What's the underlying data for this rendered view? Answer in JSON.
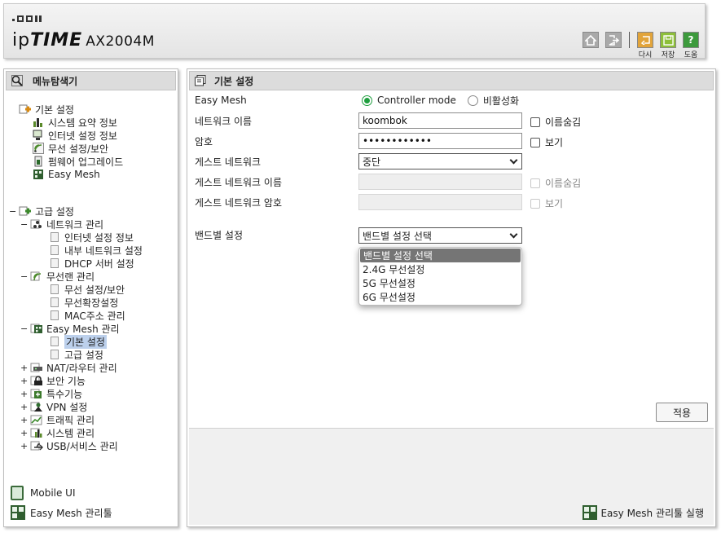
{
  "header": {
    "brand_ip": "ip",
    "brand_time": "TIME",
    "model": "AX2004M",
    "buttons": [
      {
        "icon": "home-icon"
      },
      {
        "icon": "logout-icon"
      },
      {
        "icon": "reload-icon",
        "label": "다시"
      },
      {
        "icon": "save-icon",
        "label": "저장"
      },
      {
        "icon": "help-icon",
        "label": "도움"
      }
    ]
  },
  "sidebar": {
    "title": "메뉴탐색기",
    "basic": {
      "label": "기본 설정",
      "items": [
        "시스템 요약 정보",
        "인터넷 설정 정보",
        "무선 설정/보안",
        "펌웨어 업그레이드",
        "Easy Mesh"
      ]
    },
    "advanced": {
      "label": "고급 설정",
      "network": {
        "label": "네트워크 관리",
        "items": [
          "인터넷 설정 정보",
          "내부 네트워크 설정",
          "DHCP 서버 설정"
        ]
      },
      "wireless": {
        "label": "무선랜 관리",
        "items": [
          "무선 설정/보안",
          "무선확장설정",
          "MAC주소 관리"
        ]
      },
      "easymesh": {
        "label": "Easy Mesh 관리",
        "items": [
          "기본 설정",
          "고급 설정"
        ]
      },
      "others": [
        "NAT/라우터 관리",
        "보안 기능",
        "특수기능",
        "VPN 설정",
        "트래픽 관리",
        "시스템 관리",
        "USB/서비스 관리"
      ]
    },
    "mobile_ui": "Mobile UI",
    "easy_mesh_tool": "Easy Mesh 관리툴"
  },
  "main": {
    "title": "기본 설정",
    "easy_mesh_label": "Easy Mesh",
    "mode_options": [
      "Controller mode",
      "비활성화"
    ],
    "mode_selected": "Controller mode",
    "network_name_label": "네트워크 이름",
    "network_name_value": "koombok",
    "hide_name_label": "이름숨김",
    "password_label": "암호",
    "password_value": "••••••••••••",
    "show_label": "보기",
    "guest_network_label": "게스트 네트워크",
    "guest_network_value": "중단",
    "guest_name_label": "게스트 네트워크 이름",
    "guest_hide_label": "이름숨김",
    "guest_password_label": "게스트 네트워크 암호",
    "guest_show_label": "보기",
    "band_label": "밴드별 설정",
    "band_value": "밴드별 설정 선택",
    "band_options": [
      "밴드별 설정 선택",
      "2.4G 무선설정",
      "5G 무선설정",
      "6G 무선설정"
    ],
    "apply_label": "적용",
    "run_tool_label": "Easy Mesh 관리툴 실행"
  },
  "colors": {
    "accent_green": "#1e9e3e",
    "reload_orange": "#e2a43a",
    "save_green": "#8dbf3a",
    "help_green": "#3c9a3c"
  }
}
